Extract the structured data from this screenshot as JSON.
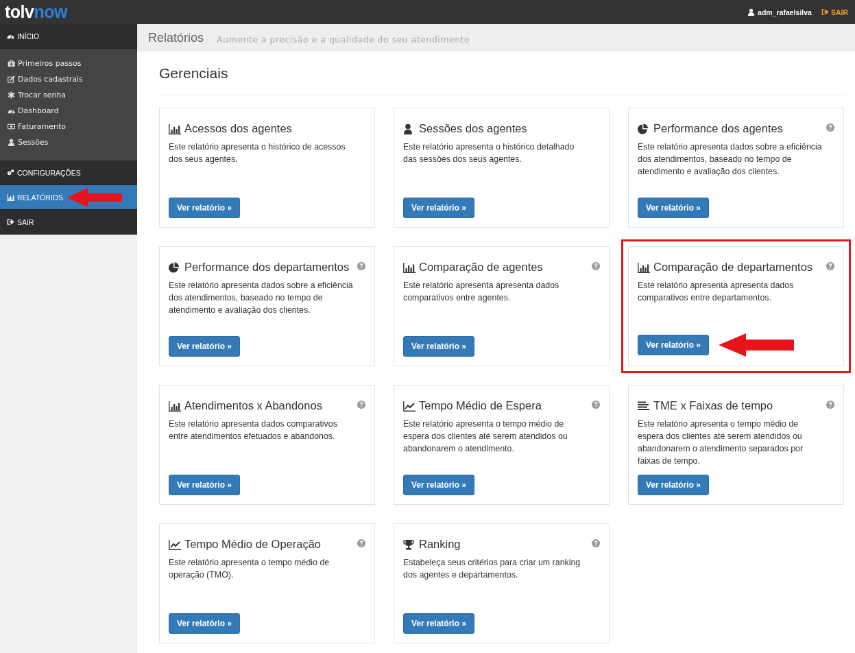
{
  "logo": {
    "first": "tolv",
    "second": "now"
  },
  "user": {
    "name": "adm_rafaelsilva",
    "logout": "SAIR"
  },
  "sidebar": [
    {
      "label": "INÍCIO",
      "selected": false,
      "arrow": false,
      "items": [
        {
          "label": "Primeiros passos"
        },
        {
          "label": "Dados cadastrais"
        },
        {
          "label": "Trocar senha"
        },
        {
          "label": "Dashboard"
        },
        {
          "label": "Faturamento"
        },
        {
          "label": "Sessões"
        }
      ]
    },
    {
      "label": "CONFIGURAÇÕES",
      "selected": false,
      "arrow": false
    },
    {
      "label": "RELATÓRIOS",
      "selected": true,
      "arrow": true
    },
    {
      "label": "SAIR",
      "selected": false,
      "arrow": false
    }
  ],
  "page_header": {
    "title": "Relatórios",
    "subtitle": "Aumente a precisão e a qualidade do seu atendimento"
  },
  "section_title": "Gerenciais",
  "cards": [
    {
      "title": "Acessos dos agentes",
      "description": "Este relatório apresenta o histórico de acessos dos seus agentes.",
      "help": false,
      "highlighted": false,
      "button": "Ver relatório »"
    },
    {
      "title": "Sessões dos agentes",
      "description": "Este relatório apresenta o histórico detalhado das sessões dos seus agentes.",
      "help": false,
      "highlighted": false,
      "button": "Ver relatório »"
    },
    {
      "title": "Performance dos agentes",
      "description": "Este relatório apresenta dados sobre a eficiência dos atendimentos, baseado no tempo de atendimento e avaliação dos clientes.",
      "help": true,
      "highlighted": false,
      "button": "Ver relatório »"
    },
    {
      "title": "Performance dos departamentos",
      "description": "Este relatório apresenta dados sobre a eficiência dos atendimentos, baseado no tempo de atendimento e avaliação dos clientes.",
      "help": true,
      "highlighted": false,
      "button": "Ver relatório »"
    },
    {
      "title": "Comparação de agentes",
      "description": "Este relatório apresenta apresenta dados comparativos entre agentes.",
      "help": true,
      "highlighted": false,
      "button": "Ver relatório »"
    },
    {
      "title": "Comparação de departamentos",
      "description": "Este relatório apresenta apresenta dados comparativos entre departamentos.",
      "help": true,
      "highlighted": true,
      "button": "Ver relatório »"
    },
    {
      "title": "Atendimentos x Abandonos",
      "description": "Este relatório apresenta dados comparativos entre atendimentos efetuados e abandonos.",
      "help": true,
      "highlighted": false,
      "button": "Ver relatório »"
    },
    {
      "title": "Tempo Médio de Espera",
      "description": "Este relatório apresenta o tempo médio de espera dos clientes até serem atendidos ou abandonarem o atendimento.",
      "help": true,
      "highlighted": false,
      "button": "Ver relatório »"
    },
    {
      "title": "TME x Faixas de tempo",
      "description": "Este relatório apresenta o tempo médio de espera dos clientes até serem atendidos ou abandonarem o atendimento separados por faixas de tempo.",
      "help": true,
      "highlighted": false,
      "button": "Ver relatório »"
    },
    {
      "title": "Tempo Médio de Operação",
      "description": "Este relatório apresenta o tempo médio de operação (TMO).",
      "help": true,
      "highlighted": false,
      "button": "Ver relatório »"
    },
    {
      "title": "Ranking",
      "description": "Estabeleça seus critérios para criar um ranking dos agentes e departamentos.",
      "help": true,
      "highlighted": false,
      "button": "Ver relatório »"
    }
  ]
}
